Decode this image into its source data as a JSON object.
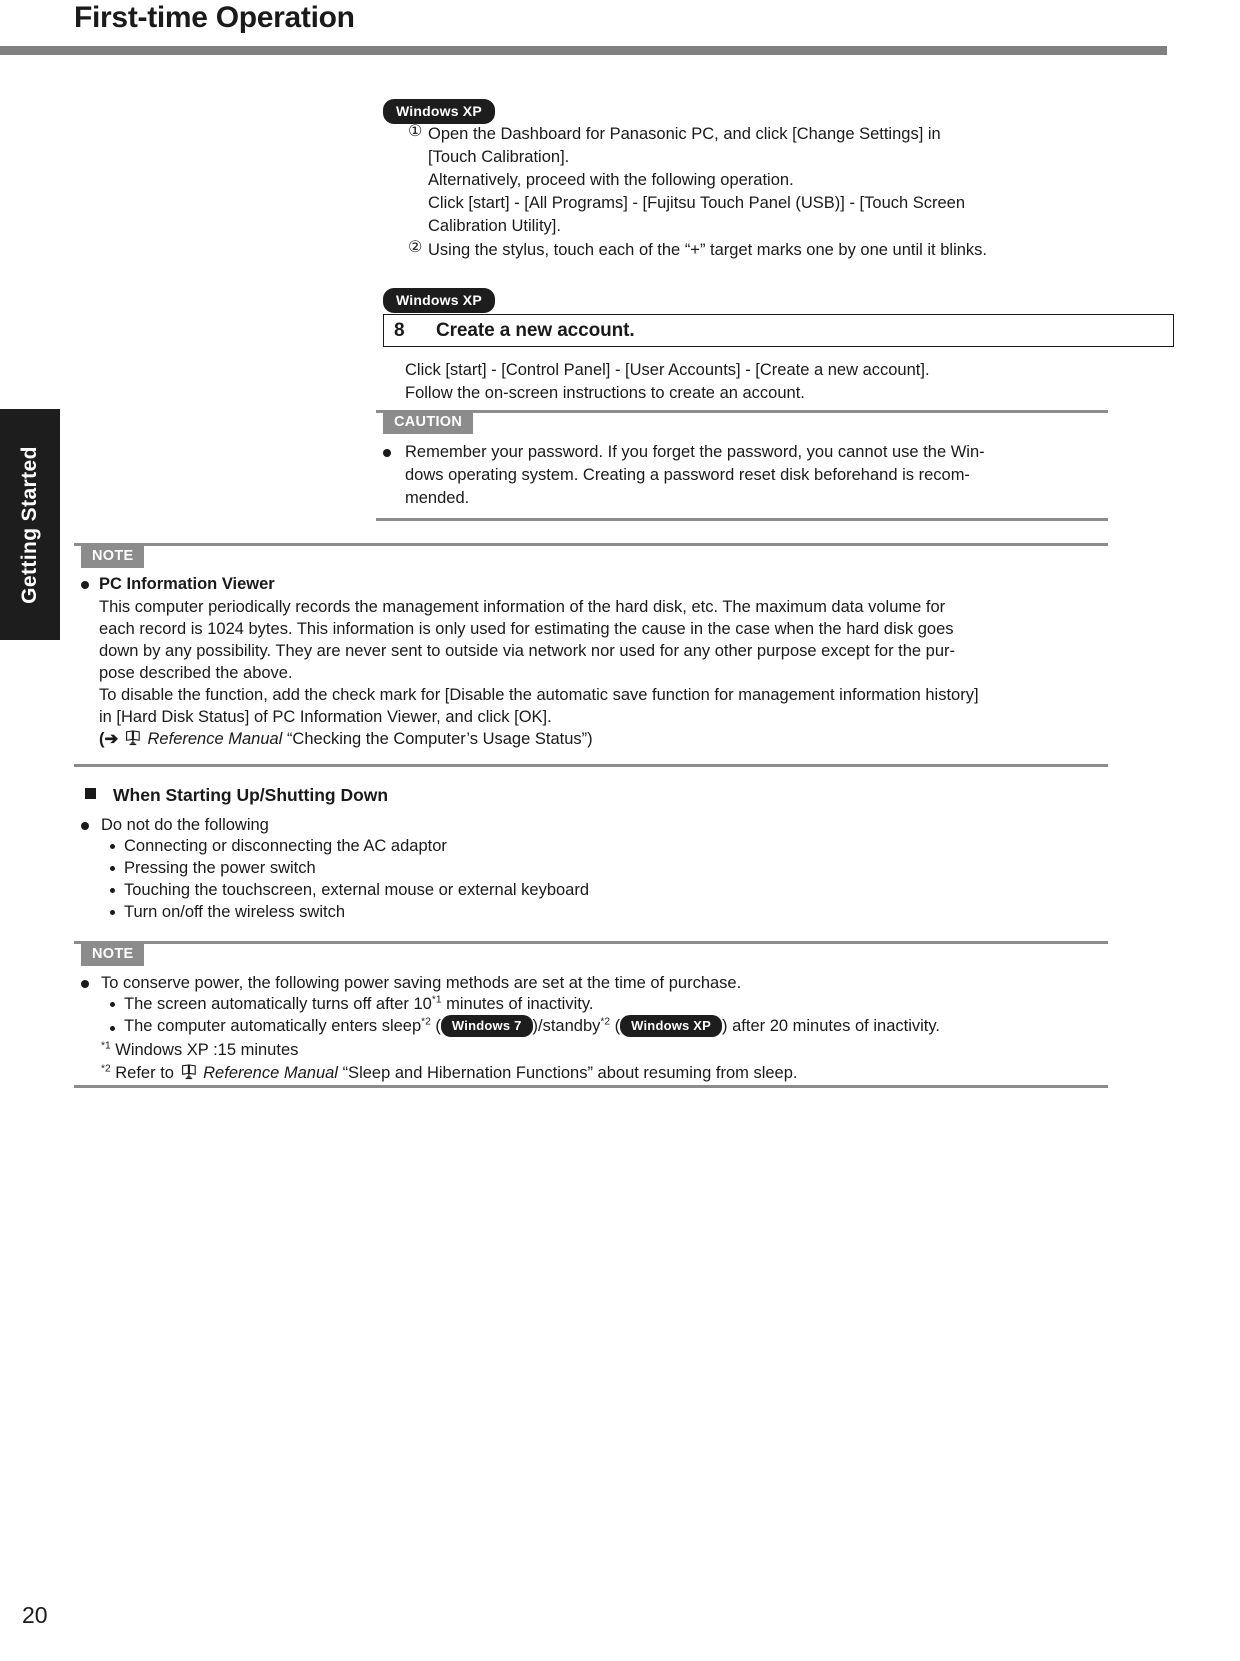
{
  "document": {
    "title": "First-time Operation",
    "page_number": "20",
    "side_tab_label": "Getting Started"
  },
  "badges": {
    "windows_xp": "Windows XP",
    "windows_7": "Windows 7"
  },
  "touch_calibration": {
    "os_badge": "Windows XP",
    "item1_marker": "①",
    "item1_line1": "Open the Dashboard for Panasonic PC, and click [Change Settings] in",
    "item1_line2": "[Touch Calibration].",
    "item1_line3": "Alternatively, proceed with the following operation.",
    "item1_line4": "Click [start] - [All Programs] - [Fujitsu Touch Panel (USB)] - [Touch Screen",
    "item1_line5": "Calibration Utility].",
    "item2_marker": "②",
    "item2_line1": "Using the stylus, touch each of the “+” target marks one by one until it blinks."
  },
  "step8": {
    "os_badge": "Windows XP",
    "number": "8",
    "title": "Create a new account.",
    "body_line1": "Click [start] - [Control Panel] - [User Accounts] - [Create a new account].",
    "body_line2": "Follow the on-screen instructions to create an account.",
    "caution_tag": "CAUTION",
    "caution_line1": "Remember your password. If you forget the password, you cannot use the Win-",
    "caution_line2": "dows operating system. Creating a password reset disk beforehand is recom-",
    "caution_line3": "mended."
  },
  "note_pc_info": {
    "tag": "NOTE",
    "heading": "PC Information Viewer",
    "line1": "This computer periodically records the management information of the hard disk, etc. The maximum data volume for",
    "line2": "each record is 1024 bytes. This information is only used for estimating the cause in the case when the hard disk goes",
    "line3": "down by any possibility. They are never sent to outside via network nor used for any other purpose except for the pur-",
    "line4": "pose described the above.",
    "line5": "To disable the function, add the check mark for [Disable the automatic save function for management information history]",
    "line6": "in [Hard Disk Status] of PC Information Viewer, and click [OK].",
    "ref_prefix": "(➔",
    "ref_manual": "Reference Manual",
    "ref_suffix": "“Checking the Computer’s Usage Status”)"
  },
  "startup_shutdown": {
    "heading": "When Starting Up/Shutting Down",
    "bullet_main": "Do not do the following",
    "sub_items": [
      "Connecting or disconnecting the AC adaptor",
      "Pressing the power switch",
      "Touching the touchscreen, external mouse or external keyboard",
      "Turn on/off the wireless switch"
    ]
  },
  "note_power": {
    "tag": "NOTE",
    "bullet_main": "To conserve power, the following power saving methods are set at the time of purchase.",
    "sub1_a": "The screen automatically turns off after 10",
    "sub1_sup": "*1",
    "sub1_b": " minutes of inactivity.",
    "sub2_a": "The computer automatically enters sleep",
    "sub2_sup1": "*2",
    "sub2_paren_open": " (",
    "sub2_mid": ")/standby",
    "sub2_sup2": "*2",
    "sub2_paren_open2": " (",
    "sub2_b": ") after 20 minutes of inactivity.",
    "fn1_sup": "*1",
    "fn1_text": " Windows XP :15 minutes",
    "fn2_sup": "*2",
    "fn2_prefix": " Refer to",
    "fn2_manual": "Reference Manual",
    "fn2_suffix": "“Sleep and Hibernation Functions” about resuming from sleep."
  }
}
